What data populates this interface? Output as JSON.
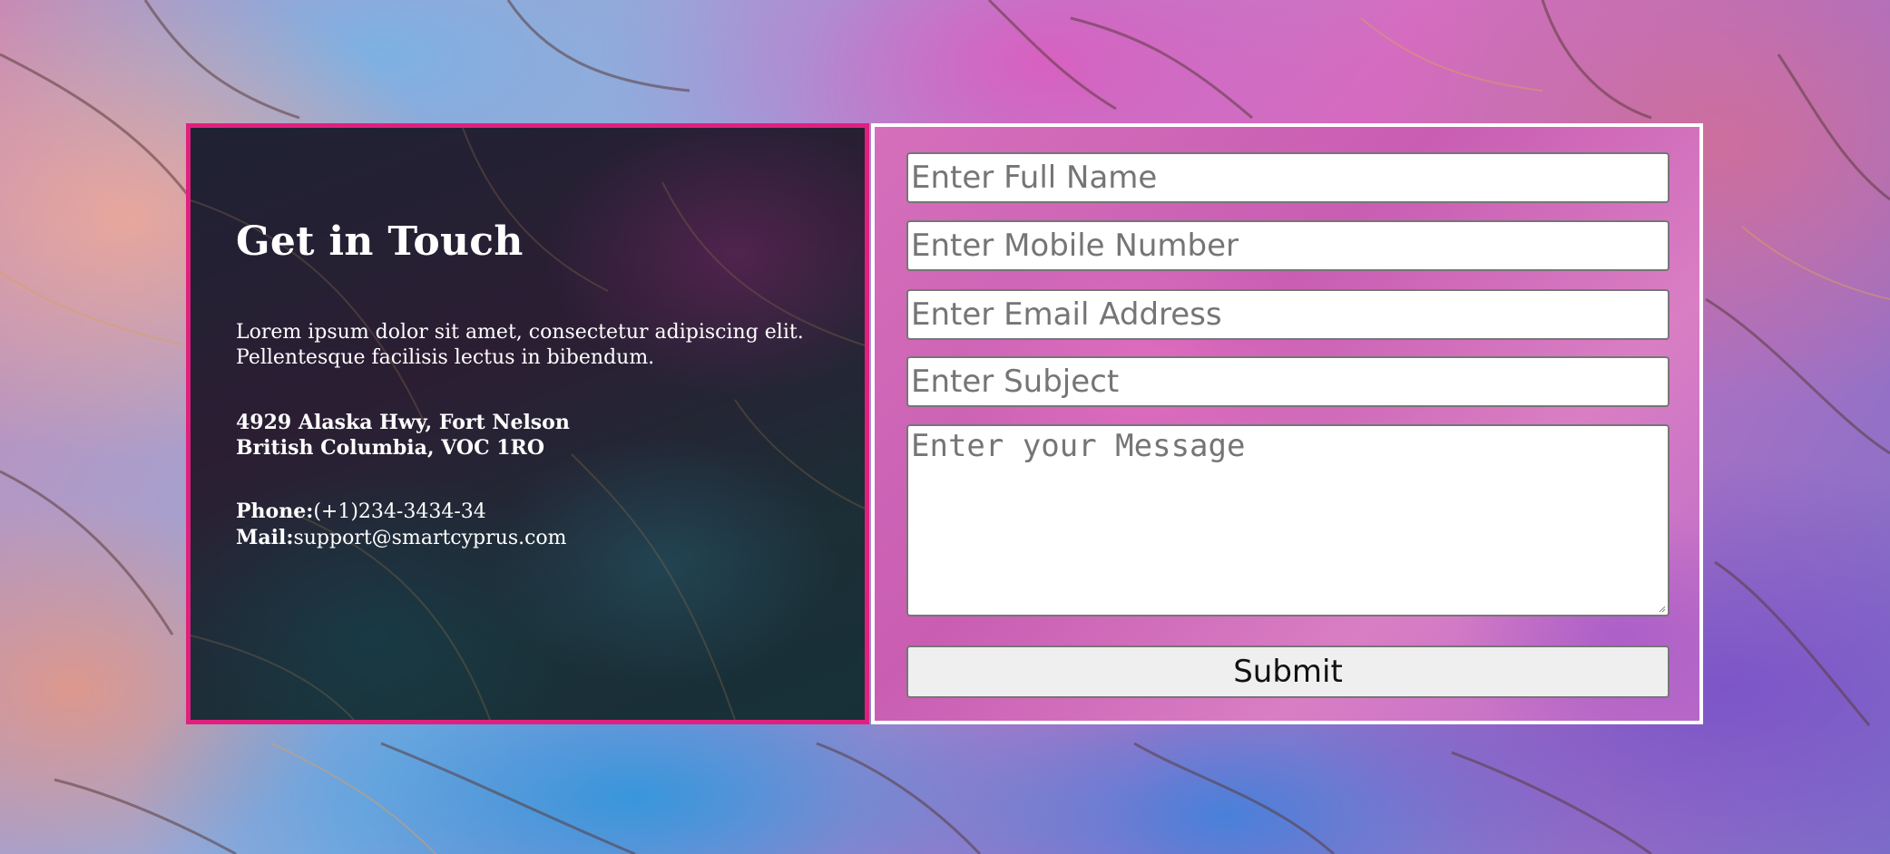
{
  "contact_info": {
    "heading": "Get in Touch",
    "intro": "Lorem ipsum dolor sit amet, consectetur adipiscing elit. Pellentesque facilisis lectus in bibendum.",
    "address_line1": "4929 Alaska Hwy, Fort Nelson",
    "address_line2": "British Columbia, VOC 1RO",
    "phone_label": "Phone:",
    "phone_value": "(+1)234-3434-34",
    "mail_label": "Mail:",
    "mail_value": "support@smartcyprus.com"
  },
  "form": {
    "full_name_placeholder": "Enter Full Name",
    "mobile_placeholder": "Enter Mobile Number",
    "email_placeholder": "Enter Email Address",
    "subject_placeholder": "Enter Subject",
    "message_placeholder": "Enter your Message",
    "submit_label": "Submit"
  },
  "colors": {
    "left_panel_border": "#e0207e",
    "right_panel_border": "#ffffff",
    "text": "#ffffff"
  }
}
